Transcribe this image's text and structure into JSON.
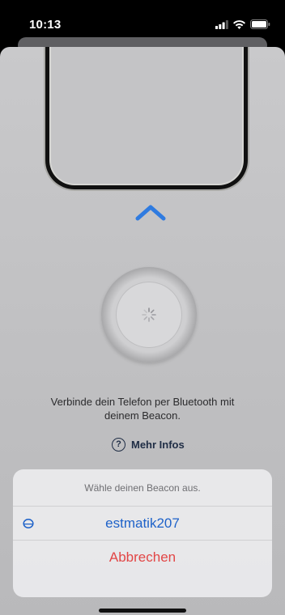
{
  "status_bar": {
    "time": "10:13",
    "icons": [
      "signal-icon",
      "wifi-icon",
      "battery-icon"
    ]
  },
  "illustration": {
    "icons": [
      "phone-illustration",
      "chevron-up-icon",
      "beacon-device",
      "spinner-icon"
    ]
  },
  "description": "Verbinde dein Telefon per Bluetooth mit deinem Beacon.",
  "info_link": {
    "icon_text": "?",
    "label": "Mehr Infos"
  },
  "action_sheet": {
    "title": "Wähle deinen Beacon aus.",
    "device": {
      "icon": "beacon-device-icon",
      "label": "estmatik207"
    },
    "cancel": "Abbrechen"
  },
  "colors": {
    "accent": "#1e62c9",
    "destructive": "#e24646",
    "link": "#1f2d45"
  }
}
